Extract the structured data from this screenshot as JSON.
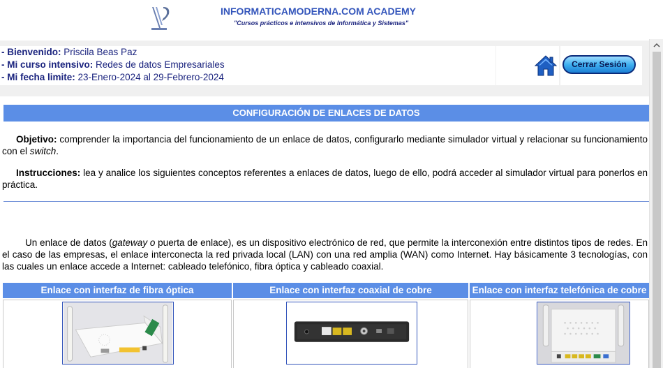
{
  "brand": {
    "title": "INFORMATICAMODERNA.COM ACADEMY",
    "subtitle": "\"Cursos prácticos e intensivos de Informática y Sistemas\""
  },
  "user": {
    "welcome_label": "- Bienvenido:",
    "welcome_value": "Priscila Beas Paz",
    "course_label": "- Mi curso intensivo:",
    "course_value": "Redes de datos Empresariales",
    "deadline_label": "- Mi fecha limite:",
    "deadline_value": "23-Enero-2024 al 29-Febrero-2024"
  },
  "actions": {
    "home_icon": "home-icon",
    "logout_label": "Cerrar Sesión"
  },
  "section": {
    "title": "CONFIGURACIÓN DE ENLACES DE DATOS"
  },
  "objective": {
    "label": "Objetivo:",
    "text": " comprender la importancia del funcionamiento de un enlace de datos, configurarlo mediante simulador virtual y relacionar su funcionamiento con el ",
    "switch_word": "switch",
    "end": "."
  },
  "instructions": {
    "label": "Instrucciones:",
    "text": " lea y analice los siguientes conceptos referentes a enlaces de datos, luego de ello, podrá acceder al simulador virtual para ponerlos en práctica."
  },
  "intro": {
    "part1": "Un enlace de datos (",
    "gateway_word": "gateway o",
    "part2": " puerta de enlace), es un dispositivo electrónico de red, que permite la interconexión entre distintos tipos de redes. En el caso de las empresas, el enlace interconecta la red privada local (LAN) con una red amplia (WAN) como Internet. Hay básicamente 3 tecnologías, con las cuales un enlace accede a Internet: cableado telefónico, fibra óptica y cableado coaxial."
  },
  "devices": [
    {
      "header": "Enlace con interfaz de fibra óptica",
      "image": "fiber-router-image"
    },
    {
      "header": "Enlace con interfaz coaxial de cobre",
      "image": "coaxial-modem-image"
    },
    {
      "header": "Enlace con interfaz telefónica de cobre",
      "image": "telephone-router-image"
    }
  ],
  "colors": {
    "accent_blue": "#5b8ee6",
    "navy_text": "#1a237e",
    "brand_blue": "#3355bb"
  }
}
